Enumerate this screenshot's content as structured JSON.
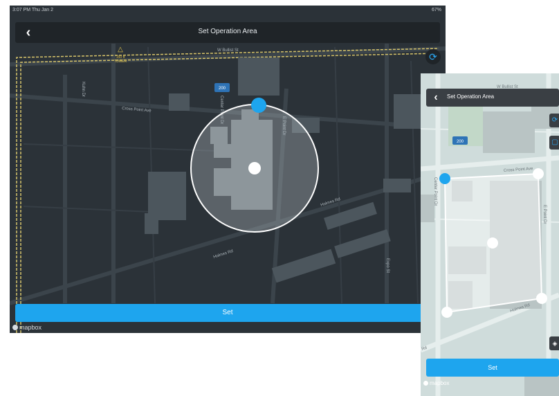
{
  "tablet": {
    "status_left": "3:07 PM  Thu Jan 2",
    "status_right": "67%",
    "title": "Set Operation Area",
    "back_icon": "chevron-left-icon",
    "refresh_icon": "refresh-icon",
    "set_label": "Set",
    "logo": "mapbox",
    "map_labels": {
      "street_top": "W Bullist St",
      "tower": "TOWER",
      "tower_height": "150 ft",
      "cross_point": "Cross Point Ave",
      "holmes": "Holmes Rd",
      "holmes2": "Holmes Rd",
      "route": "200",
      "e_point": "E Point Dr",
      "kuhn": "Kuhn Dr",
      "center_pt": "Center Point Dr",
      "expo": "Expo St"
    },
    "colors": {
      "accent": "#1ea5ee",
      "background": "#2b3238"
    }
  },
  "phone": {
    "title": "Set Operation Area",
    "back_icon": "chevron-left-icon",
    "set_label": "Set",
    "logo": "mapbox",
    "map_labels": {
      "street_top": "W Bullist St",
      "cross_point": "Cross Point Ave",
      "holmes": "Holmes Rd",
      "route": "200",
      "e_point": "E Point Dr",
      "center_pt": "Center Point Dr",
      "rd": "Rd"
    },
    "colors": {
      "accent": "#1ea5ee",
      "background": "#cfdcdb"
    }
  }
}
